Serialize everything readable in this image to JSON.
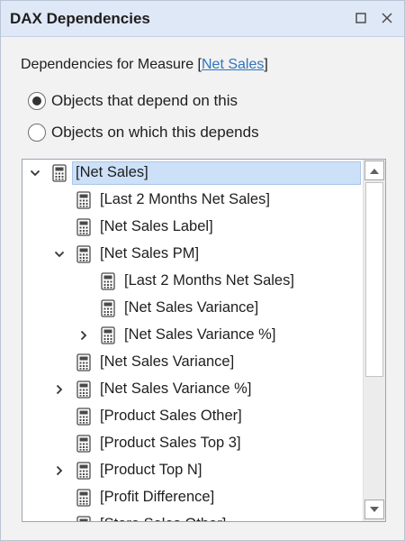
{
  "window": {
    "title": "DAX Dependencies"
  },
  "header": {
    "prefix": "Dependencies for Measure [",
    "measure_link": "Net Sales",
    "suffix": "]"
  },
  "options": [
    {
      "label": "Objects that depend on this",
      "selected": true
    },
    {
      "label": "Objects on which this depends",
      "selected": false
    }
  ],
  "tree": {
    "items": [
      {
        "label": "[Net Sales]",
        "level": 0,
        "toggle": "expanded",
        "selected": true
      },
      {
        "label": "[Last 2 Months Net Sales]",
        "level": 1,
        "toggle": "none",
        "selected": false
      },
      {
        "label": "[Net Sales Label]",
        "level": 1,
        "toggle": "none",
        "selected": false
      },
      {
        "label": "[Net Sales PM]",
        "level": 1,
        "toggle": "expanded",
        "selected": false
      },
      {
        "label": "[Last 2 Months Net Sales]",
        "level": 2,
        "toggle": "none",
        "selected": false
      },
      {
        "label": "[Net Sales Variance]",
        "level": 2,
        "toggle": "none",
        "selected": false
      },
      {
        "label": "[Net Sales Variance %]",
        "level": 2,
        "toggle": "collapsed",
        "selected": false
      },
      {
        "label": "[Net Sales Variance]",
        "level": 1,
        "toggle": "none",
        "selected": false
      },
      {
        "label": "[Net Sales Variance %]",
        "level": 1,
        "toggle": "collapsed",
        "selected": false
      },
      {
        "label": "[Product Sales Other]",
        "level": 1,
        "toggle": "none",
        "selected": false
      },
      {
        "label": "[Product Sales Top 3]",
        "level": 1,
        "toggle": "none",
        "selected": false
      },
      {
        "label": "[Product Top N]",
        "level": 1,
        "toggle": "collapsed",
        "selected": false
      },
      {
        "label": "[Profit Difference]",
        "level": 1,
        "toggle": "none",
        "selected": false
      },
      {
        "label": "[Store Sales Other]",
        "level": 1,
        "toggle": "none",
        "selected": false
      }
    ]
  },
  "colors": {
    "titlebar": "#dfe8f6",
    "link": "#2f74c0",
    "selection": "#cce0f7"
  },
  "icons": {
    "maximize": "maximize-icon",
    "close": "close-icon",
    "measure": "calculator-icon"
  }
}
